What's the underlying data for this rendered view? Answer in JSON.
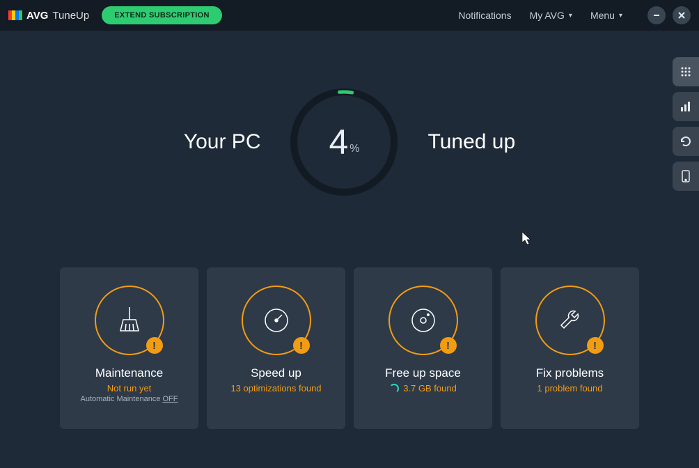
{
  "titlebar": {
    "brand_bold": "AVG",
    "brand_sub": "TuneUp",
    "extend_label": "EXTEND SUBSCRIPTION",
    "notifications": "Notifications",
    "my_avg": "My AVG",
    "menu": "Menu"
  },
  "hero": {
    "left": "Your PC",
    "right": "Tuned up",
    "value": "4",
    "unit": "%"
  },
  "cards": [
    {
      "title": "Maintenance",
      "sub": "Not run yet",
      "extra_prefix": "Automatic Maintenance ",
      "extra_toggle": "OFF",
      "icon": "broom"
    },
    {
      "title": "Speed up",
      "sub": "13 optimizations found",
      "icon": "gauge"
    },
    {
      "title": "Free up space",
      "sub": "3.7 GB found",
      "icon": "disk",
      "spinner": true
    },
    {
      "title": "Fix problems",
      "sub": "1 problem found",
      "icon": "wrench"
    }
  ],
  "side_tabs": [
    "grid",
    "chart",
    "undo",
    "phone"
  ]
}
